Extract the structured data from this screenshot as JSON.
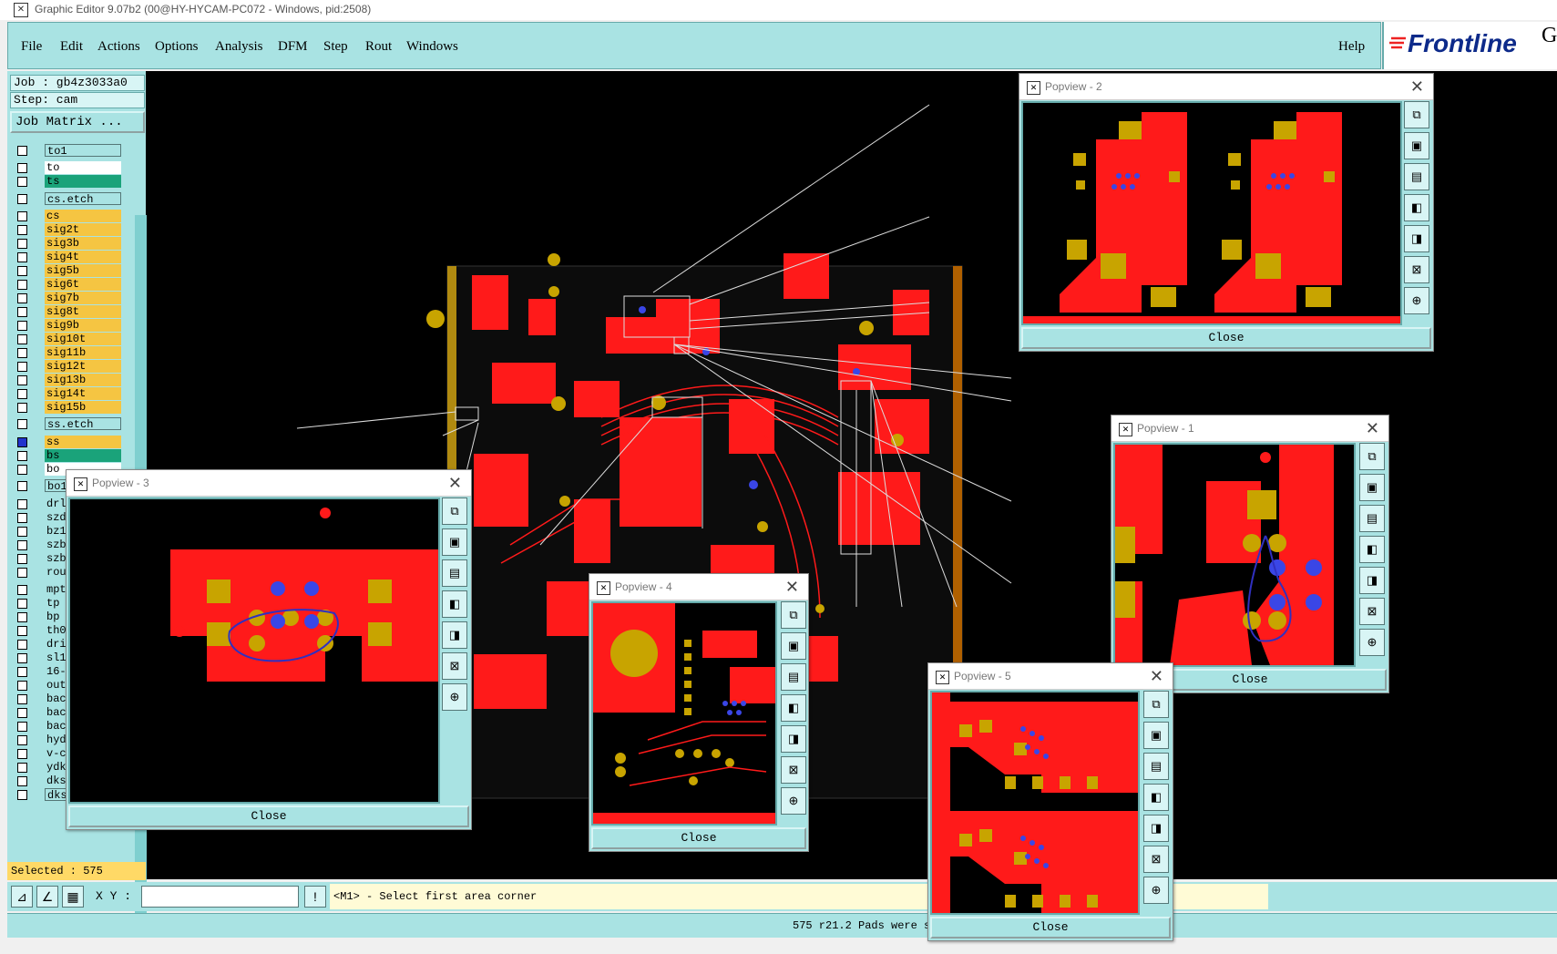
{
  "window": {
    "title": "Graphic Editor 9.07b2 (00@HY-HYCAM-PC072 - Windows, pid:2508)"
  },
  "menu": {
    "items": [
      "File",
      "Edit",
      "Actions",
      "Options",
      "Analysis",
      "DFM",
      "Step",
      "Rout",
      "Windows"
    ],
    "help": "Help"
  },
  "brand": {
    "logo": "Frontline",
    "extra": "Ge"
  },
  "job": {
    "job_line": "Job : gb4z3033a0",
    "step_line": "Step: cam",
    "matrix_button": "Job Matrix ..."
  },
  "layers": [
    "to1",
    "to",
    "ts",
    "cs.etch",
    "cs",
    "sig2t",
    "sig3b",
    "sig4t",
    "sig5b",
    "sig6t",
    "sig7b",
    "sig8t",
    "sig9b",
    "sig10t",
    "sig11b",
    "sig12t",
    "sig13b",
    "sig14t",
    "sig15b",
    "ss.etch",
    "ss",
    "bs",
    "bo",
    "bo1",
    "drl",
    "szd",
    "bz1",
    "szb",
    "szb",
    "rou",
    "mpt",
    "tp",
    "bp",
    "th0",
    "dri",
    "sl1",
    "16-",
    "out",
    "bac",
    "bac",
    "bac",
    "hyd",
    "v-c",
    "ydk",
    "dks",
    "dksb"
  ],
  "selected": "Selected : 575",
  "coords": {
    "label": "X Y :",
    "value": ""
  },
  "prompt": "<M1> - Select first area corner",
  "status": "575 r21.2 Pads were s",
  "popups": [
    {
      "title": "Popview - 1",
      "close": "Close"
    },
    {
      "title": "Popview - 2",
      "close": "Close"
    },
    {
      "title": "Popview - 3",
      "close": "Close"
    },
    {
      "title": "Popview - 4",
      "close": "Close"
    },
    {
      "title": "Popview - 5",
      "close": "Close"
    }
  ],
  "view_buttons": [
    "zoom-home-icon",
    "zoom-in-icon",
    "zoom-out-icon",
    "pan-left-icon",
    "pan-right-icon",
    "fit-icon",
    "center-icon"
  ],
  "colors": {
    "copper": "#ff1a1a",
    "pad": "#c8a400",
    "via": "#3a46e6",
    "panel": "#a9e3e3",
    "background": "#000000"
  }
}
